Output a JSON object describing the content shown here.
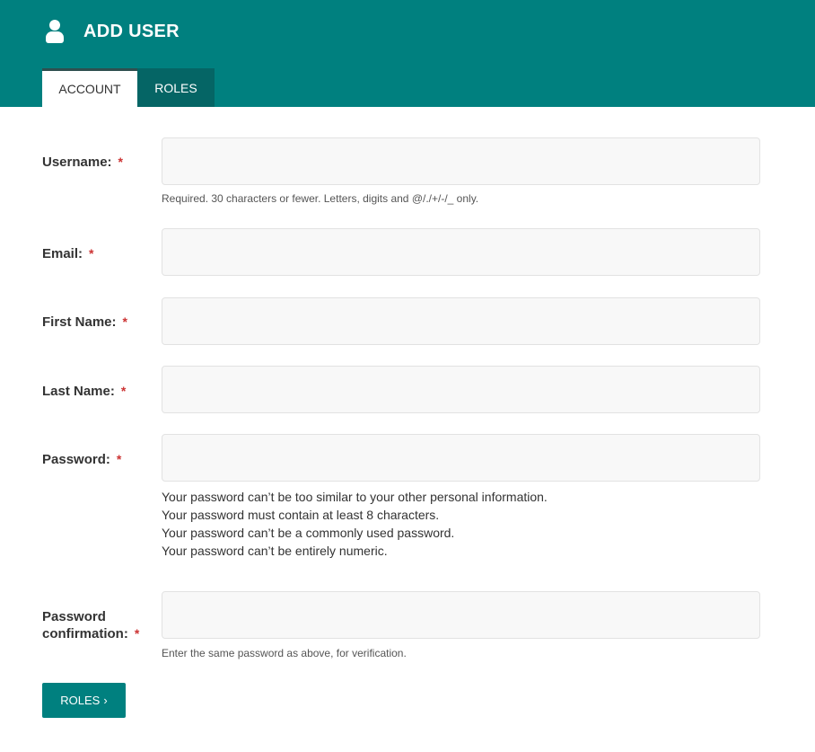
{
  "header": {
    "title": "ADD USER",
    "icon": "user-icon",
    "bg_color": "#00807f"
  },
  "tabs": [
    {
      "label": "ACCOUNT",
      "active": true
    },
    {
      "label": "ROLES",
      "active": false
    }
  ],
  "form": {
    "required_marker": "*",
    "username": {
      "label": "Username:",
      "value": "",
      "placeholder": "",
      "help": "Required. 30 characters or fewer. Letters, digits and @/./+/-/_ only."
    },
    "email": {
      "label": "Email:",
      "value": "",
      "placeholder": ""
    },
    "first_name": {
      "label": "First Name:",
      "value": "",
      "placeholder": ""
    },
    "last_name": {
      "label": "Last Name:",
      "value": "",
      "placeholder": ""
    },
    "password": {
      "label": "Password:",
      "value": "",
      "placeholder": "",
      "help": [
        "Your password can’t be too similar to your other personal information.",
        "Your password must contain at least 8 characters.",
        "Your password can’t be a commonly used password.",
        "Your password can’t be entirely numeric."
      ]
    },
    "password_confirmation": {
      "label_line1": "Password",
      "label_line2": "confirmation:",
      "value": "",
      "placeholder": "",
      "help": "Enter the same password as above, for verification."
    }
  },
  "footer": {
    "roles_button_label": "ROLES",
    "roles_button_icon": "›"
  }
}
